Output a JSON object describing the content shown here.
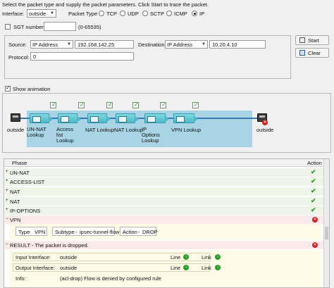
{
  "instructions": "Select the packet type and supply the packet parameters. Click Start to trace the packet.",
  "interface": {
    "label": "Interface:",
    "value": "outside"
  },
  "packet_type": {
    "label": "Packet Type",
    "options": [
      "TCP",
      "UDP",
      "SCTP",
      "ICMP",
      "IP"
    ],
    "selected": "IP"
  },
  "sgt": {
    "label": "SGT number",
    "value": "",
    "range": "(0-65535)"
  },
  "source": {
    "label": "Source:",
    "type": "IP Address",
    "value": "192.168.142.25"
  },
  "destination": {
    "label": "Destination:",
    "type": "IP Address",
    "value": "10.20.4.10"
  },
  "protocol": {
    "label": "Protocol:",
    "value": "0"
  },
  "buttons": {
    "start": "Start",
    "clear": "Clear"
  },
  "show_animation": {
    "label": "Show animation",
    "checked": true
  },
  "flow": {
    "left_label": "outside",
    "right_label": "outside",
    "stages": [
      "UN-NAT Lookup",
      "Access list Lookup",
      "NAT Lookup",
      "NAT Lookup",
      "IP Options Lookup",
      "VPN Lookup"
    ]
  },
  "table": {
    "col_phase": "Phase",
    "col_action": "Action",
    "phases": [
      {
        "name": "UN-NAT",
        "status": "allow"
      },
      {
        "name": "ACCESS-LIST",
        "status": "allow"
      },
      {
        "name": "NAT",
        "status": "allow"
      },
      {
        "name": "NAT",
        "status": "allow"
      },
      {
        "name": "IP-OPTIONS",
        "status": "allow"
      },
      {
        "name": "VPN",
        "status": "drop"
      }
    ],
    "vpn_detail": {
      "type_label": "Type",
      "type_value": "VPN",
      "subtype_label": "Subtype",
      "subtype_value": "ipsec-tunnel-flow",
      "action_label": "Action",
      "action_value": "DROP"
    },
    "result": {
      "title": "RESULT - The packet is dropped.",
      "input_label": "Input Interface:",
      "input_value": "outside",
      "output_label": "Output Interface:",
      "output_value": "outside",
      "line_label": "Line",
      "link_label": "Link",
      "info_label": "Info:",
      "info_value": "(acl-drop) Flow is denied by configured rule"
    }
  },
  "colors": {
    "allow": "#2a9a2a",
    "drop": "#d42020",
    "phase_bg": "#eef5e8",
    "detail_bg": "#fdfbe6",
    "flow_bg": "#a8d4e6"
  }
}
